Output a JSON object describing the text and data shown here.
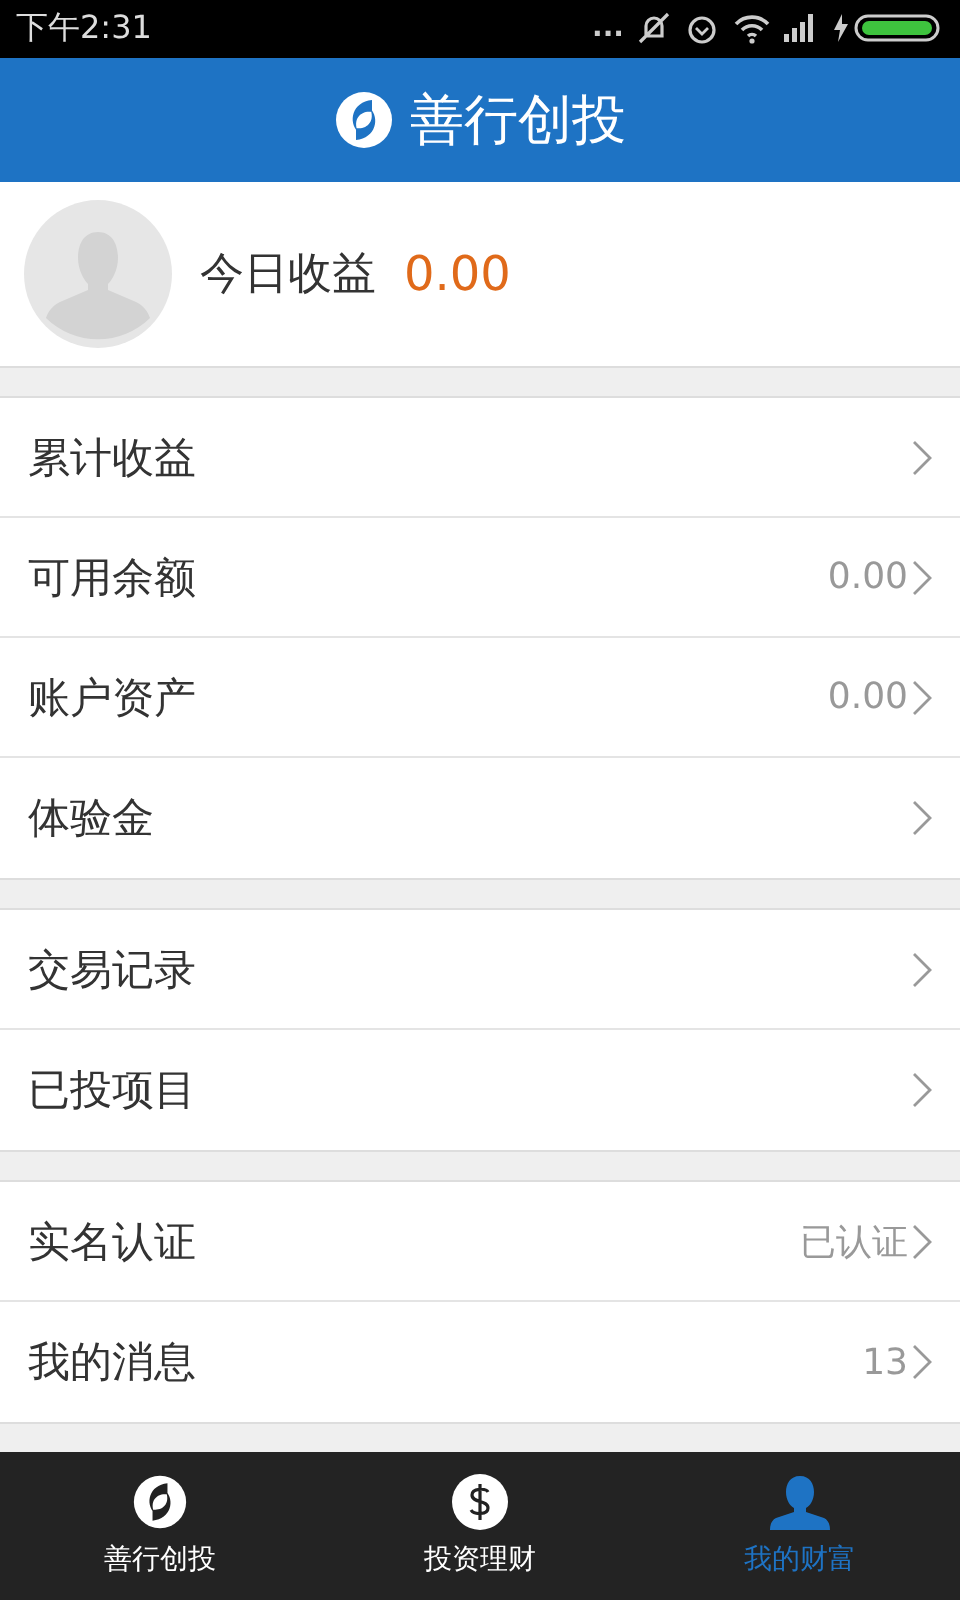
{
  "status_bar": {
    "time": "下午2:31",
    "dots": "..."
  },
  "header": {
    "title": "善行创投"
  },
  "profile": {
    "label": "今日收益",
    "value": "0.00"
  },
  "groups": [
    {
      "rows": [
        {
          "label": "累计收益"
        },
        {
          "label": "可用余额",
          "value": "0.00"
        },
        {
          "label": "账户资产",
          "value": "0.00"
        },
        {
          "label": "体验金"
        }
      ]
    },
    {
      "rows": [
        {
          "label": "交易记录"
        },
        {
          "label": "已投项目"
        }
      ]
    },
    {
      "rows": [
        {
          "label": "实名认证",
          "value": "已认证"
        },
        {
          "label": "我的消息",
          "value": "13"
        }
      ]
    }
  ],
  "tabs": [
    {
      "label": "善行创投",
      "kind": "logo",
      "selected": false
    },
    {
      "label": "投资理财",
      "kind": "dollar",
      "selected": false
    },
    {
      "label": "我的财富",
      "kind": "person",
      "selected": true
    }
  ]
}
